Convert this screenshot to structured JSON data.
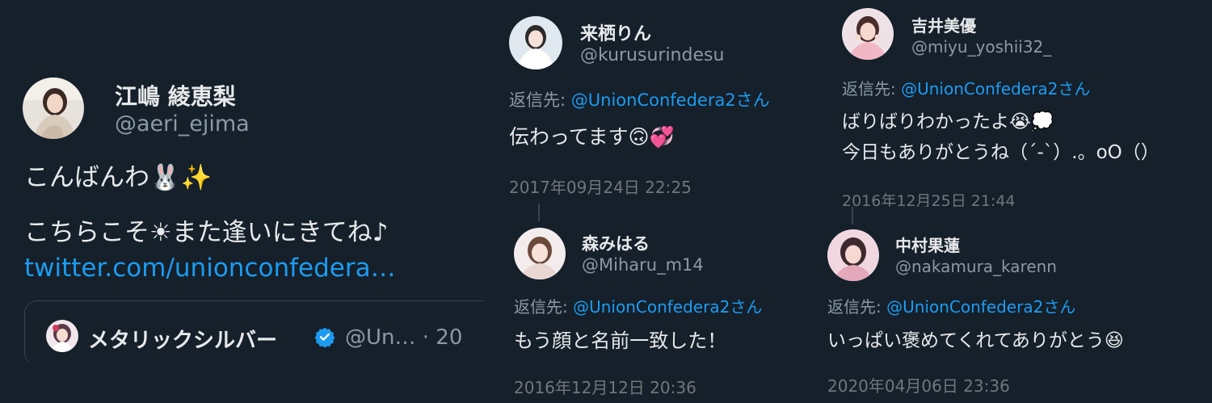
{
  "main_tweet": {
    "display_name": "江嶋 綾恵梨",
    "handle": "@aeri_ejima",
    "line1": "こんばんわ🐰✨",
    "line2": "こちらこそ☀また逢いにきてね♪",
    "link": "twitter.com/unionconfedera…",
    "quote": {
      "display_name": "メタリックシルバー",
      "handle": "@Un… · 20"
    }
  },
  "replies": [
    {
      "display_name": "来栖りん",
      "handle": "@kurusurindesu",
      "reply_prefix": "返信先: ",
      "reply_to": "@UnionConfedera2さん",
      "text": "伝わってます🙃💞",
      "date": "2017年09月24日 22:25"
    },
    {
      "display_name": "吉井美優",
      "handle": "@miyu_yoshii32_",
      "reply_prefix": "返信先: ",
      "reply_to": "@UnionConfedera2さん",
      "text": "ばりばりわかったよ😭💭",
      "text2": "今日もありがとうね（´-`）.。oO（）",
      "date": "2016年12月25日 21:44"
    },
    {
      "display_name": "森みはる",
      "handle": "@Miharu_m14",
      "reply_prefix": "返信先: ",
      "reply_to": "@UnionConfedera2さん",
      "text": "もう顔と名前一致した！",
      "date": "2016年12月12日 20:36"
    },
    {
      "display_name": "中村果蓮",
      "handle": "@nakamura_karenn",
      "reply_prefix": "返信先: ",
      "reply_to": "@UnionConfedera2さん",
      "text": "いっぱい褒めてくれてありがとう😆",
      "date": "2020年04月06日 23:36"
    }
  ],
  "colors": {
    "background": "#15202b",
    "text_primary": "#e7e9ea",
    "text_secondary": "#8b98a5",
    "link": "#1d9bf0",
    "border": "#38444d"
  }
}
